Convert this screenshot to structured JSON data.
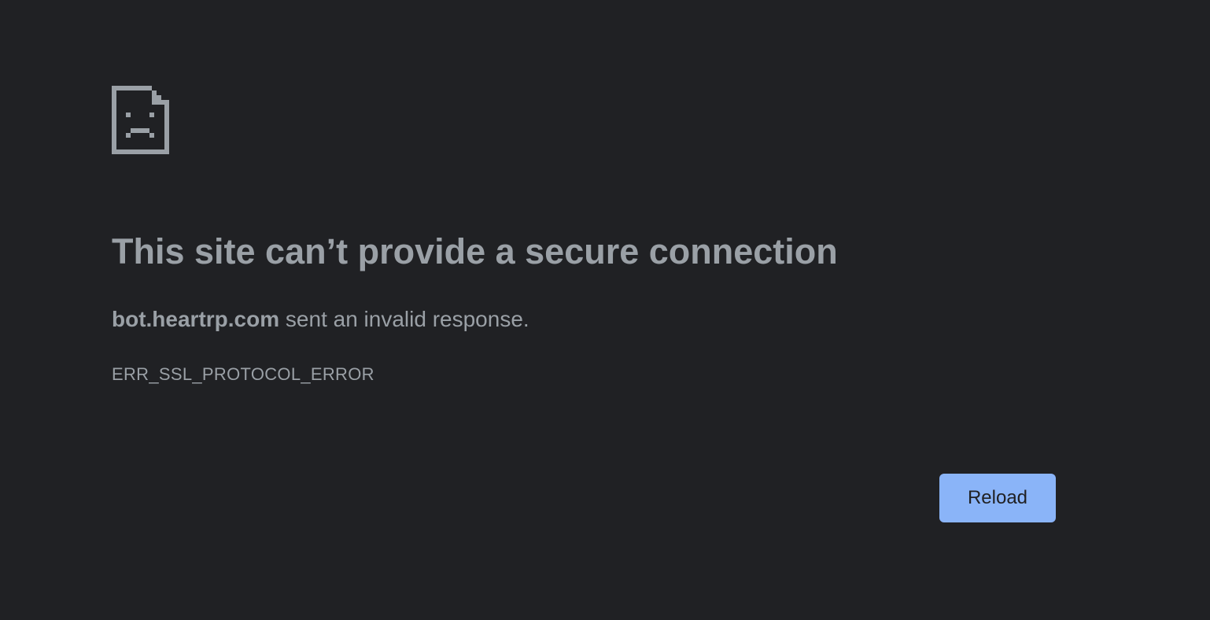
{
  "icon": {
    "name": "sad-file-icon",
    "color": "#9aa0a6"
  },
  "error": {
    "title": "This site can’t provide a secure connection",
    "host": "bot.heartrp.com",
    "message": " sent an invalid response.",
    "code": "ERR_SSL_PROTOCOL_ERROR"
  },
  "actions": {
    "reload_label": "Reload"
  },
  "colors": {
    "background": "#202124",
    "text": "#9aa0a6",
    "button": "#8ab4f8",
    "button_text": "#202124"
  }
}
